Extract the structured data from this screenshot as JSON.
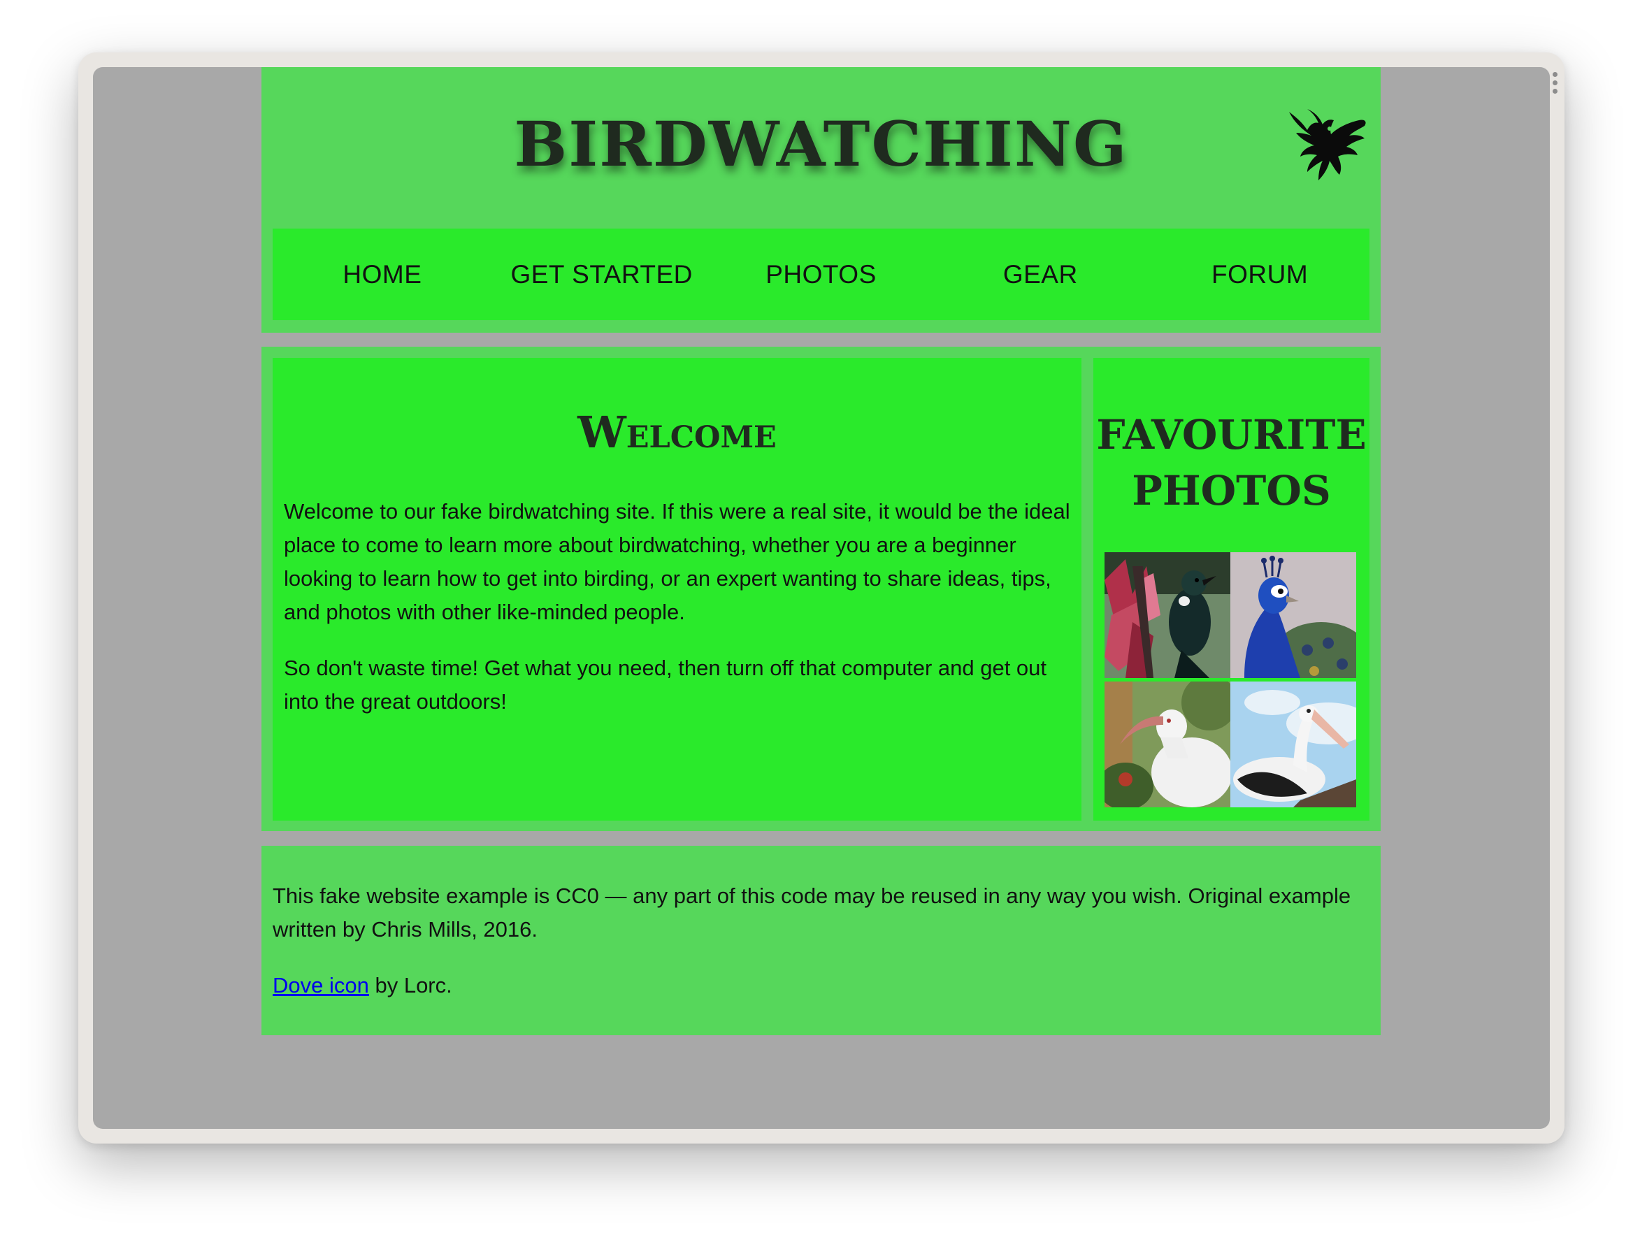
{
  "header": {
    "title": "BIRDWATCHING",
    "logo_icon": "dove-icon"
  },
  "nav": {
    "items": [
      {
        "label": "HOME"
      },
      {
        "label": "GET STARTED"
      },
      {
        "label": "PHOTOS"
      },
      {
        "label": "GEAR"
      },
      {
        "label": "FORUM"
      }
    ]
  },
  "main": {
    "heading": "Welcome",
    "paragraphs": [
      "Welcome to our fake birdwatching site. If this were a real site, it would be the ideal place to come to learn more about birdwatching, whether you are a beginner looking to learn how to get into birding, or an expert wanting to share ideas, tips, and photos with other like-minded people.",
      "So don't waste time! Get what you need, then turn off that computer and get out into the great outdoors!"
    ]
  },
  "sidebar": {
    "heading": "FAVOURITE PHOTOS",
    "photos": [
      {
        "subject": "tui-bird"
      },
      {
        "subject": "peacock"
      },
      {
        "subject": "ibis"
      },
      {
        "subject": "pelican"
      }
    ]
  },
  "footer": {
    "license_text": "This fake website example is CC0 — any part of this code may be reused in any way you wish. Original example written by Chris Mills, 2016.",
    "credit_link": "Dove icon",
    "credit_suffix": " by Lorc."
  },
  "colors": {
    "page_bg": "#a8a8a8",
    "panel_bg": "#56d75b",
    "inner_bg": "#2aea2b",
    "link": "#0000ee"
  }
}
